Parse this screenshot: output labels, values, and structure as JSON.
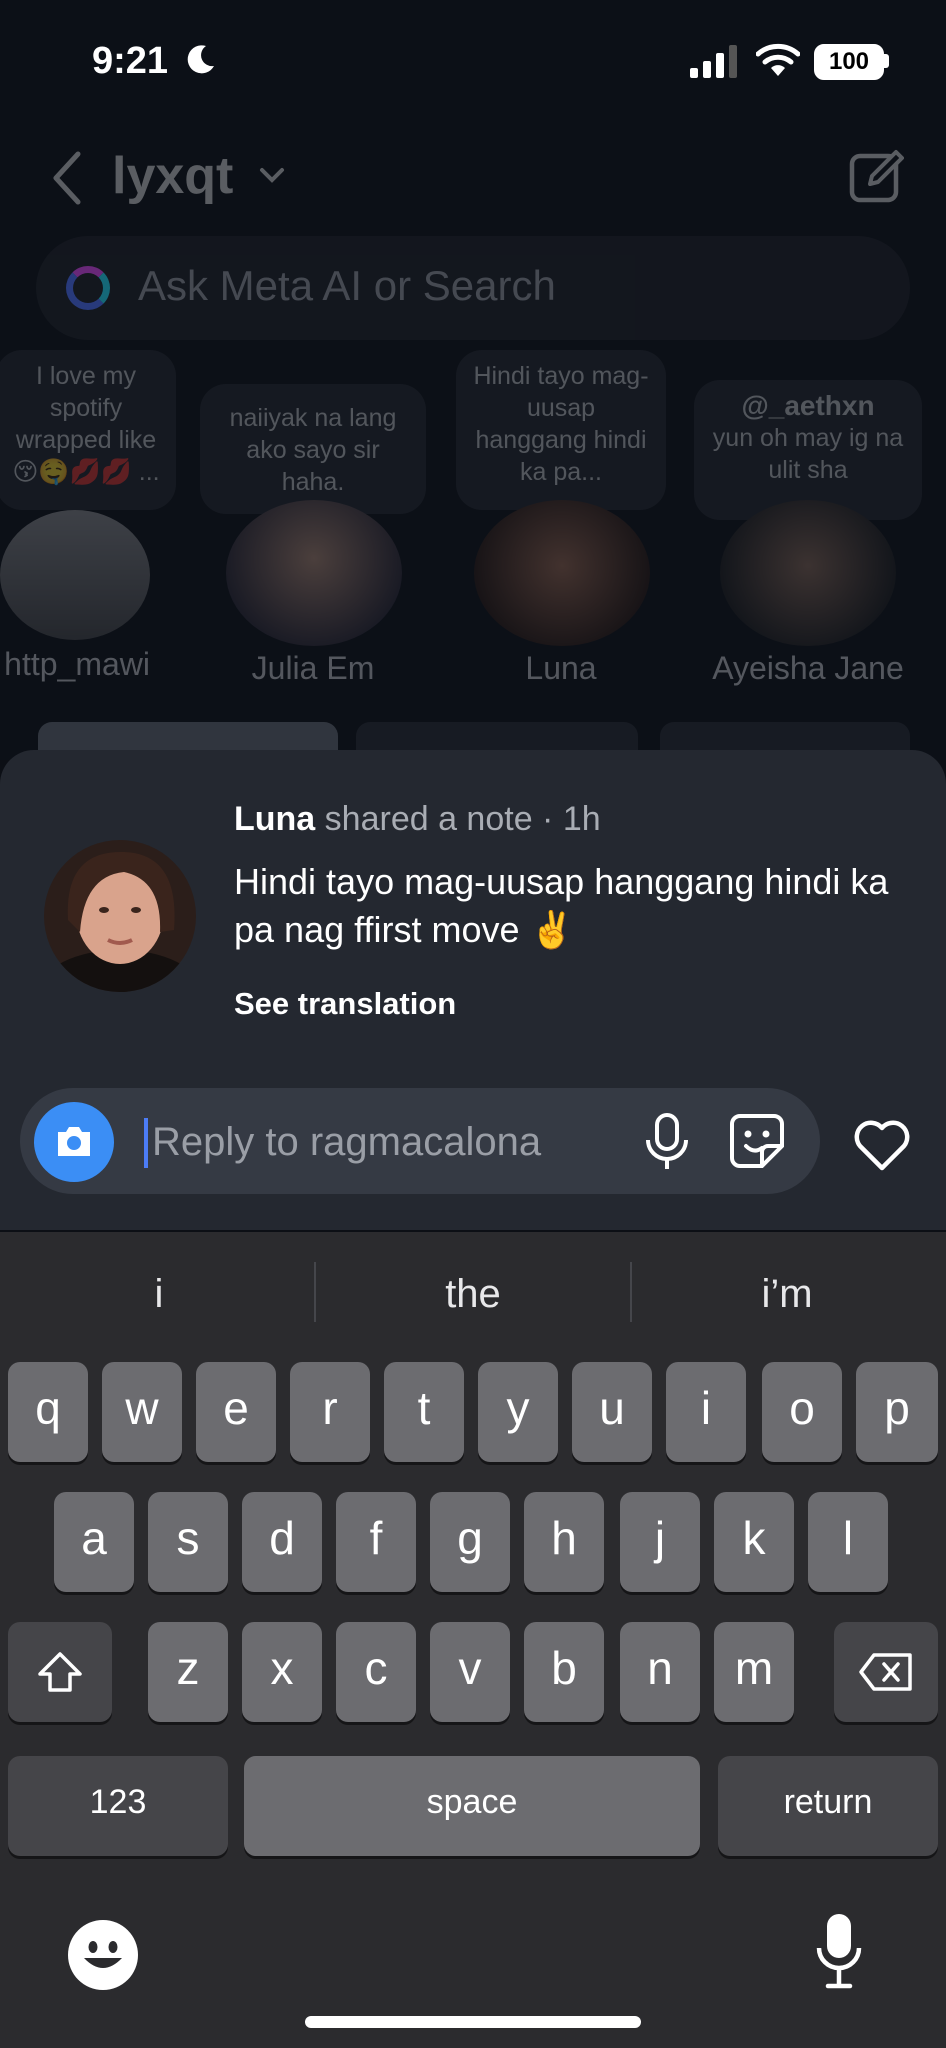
{
  "status": {
    "time": "9:21",
    "battery": "100"
  },
  "header": {
    "username": "lyxqt"
  },
  "search": {
    "placeholder": "Ask Meta AI or Search"
  },
  "notes": [
    {
      "note": "I love my spotify wrapped like 😚🤤💋💋 ...",
      "name": "http_mawi"
    },
    {
      "note": "naiiyak na lang ako sayo sir haha.",
      "name": "Julia Em"
    },
    {
      "note": "Hindi tayo mag-uusap hanggang hindi ka pa...",
      "name": "Luna"
    },
    {
      "note_handle": "@_aethxn",
      "note": "yun oh may ig na ulit sha",
      "name": "Ayeisha Jane"
    }
  ],
  "sheet": {
    "author": "Luna",
    "meta_suffix": "shared a note · 1h",
    "note_text": "Hindi tayo mag-uusap hanggang hindi ka pa nag ffirst move ✌️",
    "see_translation": "See translation",
    "reply_placeholder": "Reply to ragmacalona"
  },
  "keyboard": {
    "suggestions": [
      "i",
      "the",
      "i’m"
    ],
    "row1": [
      "q",
      "w",
      "e",
      "r",
      "t",
      "y",
      "u",
      "i",
      "o",
      "p"
    ],
    "row2": [
      "a",
      "s",
      "d",
      "f",
      "g",
      "h",
      "j",
      "k",
      "l"
    ],
    "row3": [
      "z",
      "x",
      "c",
      "v",
      "b",
      "n",
      "m"
    ],
    "numbers_label": "123",
    "space_label": "space",
    "return_label": "return"
  },
  "colors": {
    "accent": "#3b8ef5",
    "sheet": "#242830",
    "keyboard": "#2b2b2e"
  }
}
